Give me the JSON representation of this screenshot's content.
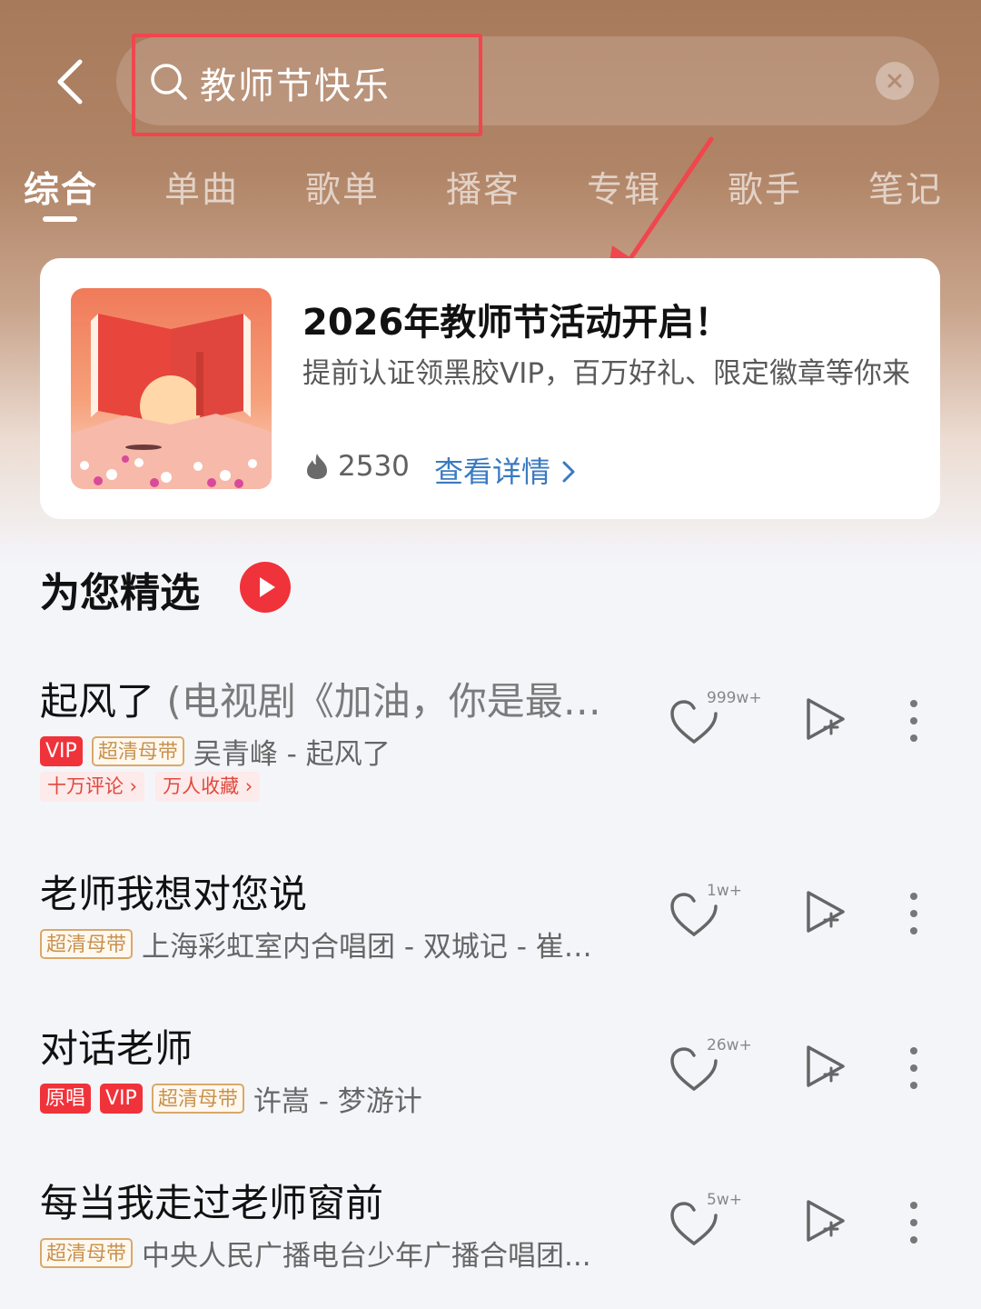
{
  "search": {
    "query": "教师节快乐"
  },
  "tabs": [
    {
      "label": "综合"
    },
    {
      "label": "单曲"
    },
    {
      "label": "歌单"
    },
    {
      "label": "播客"
    },
    {
      "label": "专辑"
    },
    {
      "label": "歌手"
    },
    {
      "label": "笔记"
    }
  ],
  "promo": {
    "title": "2026年教师节活动开启！",
    "description": "提前认证领黑胶VIP，百万好礼、限定徽章等你来",
    "heat": "2530",
    "link": "查看详情"
  },
  "section": {
    "title": "为您精选"
  },
  "songs": [
    {
      "title": "起风了",
      "subtitle": "(电视剧《加油，你是最…",
      "tags": [
        "VIP",
        "超清母带"
      ],
      "artist": "吴青峰 - 起风了",
      "chips": [
        "十万评论",
        "万人收藏"
      ],
      "likes": "999w+"
    },
    {
      "title": "老师我想对您说",
      "tags": [
        "超清母带"
      ],
      "artist": "上海彩虹室内合唱团 - 双城记 - 崔…",
      "likes": "1w+"
    },
    {
      "title": "对话老师",
      "tags": [
        "原唱",
        "VIP",
        "超清母带"
      ],
      "artist": "许嵩 - 梦游计",
      "likes": "26w+"
    },
    {
      "title": "每当我走过老师窗前",
      "tags": [
        "超清母带"
      ],
      "artist": "中央人民广播电台少年广播合唱团...",
      "likes": "5w+"
    }
  ],
  "colors": {
    "accent_red": "#f0323a",
    "link_blue": "#3a7ac2",
    "annotation_red": "#f0464e",
    "header_brown": "#a87a5c"
  }
}
